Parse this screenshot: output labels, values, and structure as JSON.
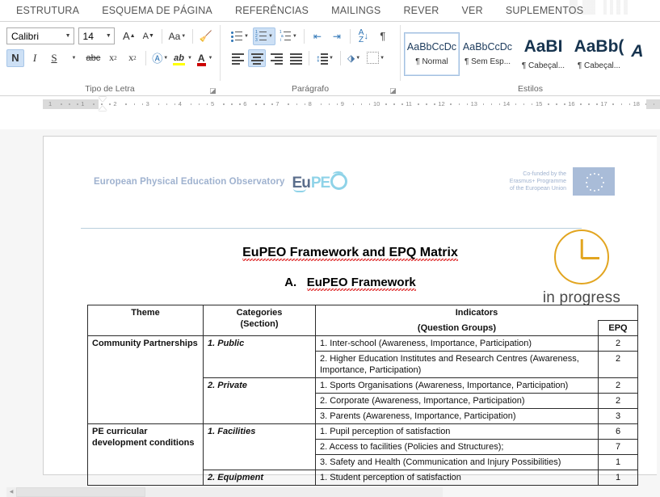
{
  "ribbon": {
    "tabs": [
      {
        "label": "ESTRUTURA",
        "active": false
      },
      {
        "label": "ESQUEMA DE PÁGINA",
        "active": false
      },
      {
        "label": "REFERÊNCIAS",
        "active": false
      },
      {
        "label": "MAILINGS",
        "active": false
      },
      {
        "label": "REVER",
        "active": false
      },
      {
        "label": "VER",
        "active": false
      },
      {
        "label": "SUPLEMENTOS",
        "active": false
      }
    ],
    "font_group": {
      "label": "Tipo de Letra",
      "font_name": "Calibri",
      "font_size": "14",
      "grow_font": "A",
      "shrink_font": "A",
      "change_case": "Aa",
      "clear_formatting": "clear-formatting-icon",
      "bold": "N",
      "italic": "I",
      "underline": "S",
      "strikethrough": "abc",
      "subscript": "x₂",
      "superscript": "x²",
      "text_effects": "A",
      "highlight": "ab",
      "font_color": "A"
    },
    "paragraph_group": {
      "label": "Parágrafo",
      "bullets": "bullet-list-icon",
      "numbering": "numbered-list-icon",
      "multilevel": "multilevel-list-icon",
      "decrease_indent": "decrease-indent-icon",
      "increase_indent": "increase-indent-icon",
      "sort": "sort-icon",
      "show_marks": "¶",
      "align_left": "align-left-icon",
      "align_center": "align-center-icon",
      "align_right": "align-right-icon",
      "justify": "justify-icon",
      "line_spacing": "line-spacing-icon",
      "shading": "shading-icon",
      "borders": "borders-icon"
    },
    "styles_group": {
      "label": "Estilos",
      "items": [
        {
          "sample": "AaBbCcDc",
          "name": "¶ Normal",
          "selected": true,
          "big": false
        },
        {
          "sample": "AaBbCcDc",
          "name": "¶ Sem Esp...",
          "selected": false,
          "big": false
        },
        {
          "sample": "AaBI",
          "name": "¶ Cabeçal...",
          "selected": false,
          "big": true
        },
        {
          "sample": "AaBb(",
          "name": "¶ Cabeçal...",
          "selected": false,
          "big": true
        },
        {
          "sample": "A",
          "name": "",
          "selected": false,
          "big": true
        }
      ]
    }
  },
  "ruler": {
    "ticks": [
      "1",
      "1",
      "2",
      "3",
      "4",
      "5",
      "6",
      "7",
      "8",
      "9",
      "10",
      "11",
      "12",
      "13",
      "14",
      "15",
      "16",
      "17",
      "18"
    ]
  },
  "document": {
    "brand_text": "European Physical Education Observatory",
    "logo": {
      "eu": "Eu",
      "pe": "PE",
      "o": "o-ring-icon"
    },
    "erasmus": {
      "line1": "Co-funded by the",
      "line2": "Erasmus+ Programme",
      "line3": "of the European Union",
      "flag": "eu-flag-icon"
    },
    "title": "EuPEO Framework and EPQ Matrix",
    "subtitle_letter": "A.",
    "subtitle": "EuPEO Framework",
    "status": {
      "icon": "clock-icon",
      "label": "in progress",
      "color": "#e2a520"
    },
    "table": {
      "headers": {
        "theme": "Theme",
        "categories_l1": "Categories",
        "categories_l2": "(Section)",
        "indicators_l1": "Indicators",
        "indicators_l2": "(Question Groups)",
        "epq": "EPQ"
      },
      "rows": [
        {
          "theme": "Community Partnerships",
          "theme_rowspan": 5,
          "category": "1. Public",
          "cat_rowspan": 2,
          "indicator": "1. Inter-school (Awareness, Importance, Participation)",
          "epq": "2"
        },
        {
          "theme": null,
          "category": null,
          "indicator": "2. Higher Education Institutes and Research Centres (Awareness, Importance, Participation)",
          "epq": "2"
        },
        {
          "theme": null,
          "category": "2. Private",
          "cat_rowspan": 3,
          "indicator": "1. Sports Organisations (Awareness, Importance, Participation)",
          "epq": "2"
        },
        {
          "theme": null,
          "category": null,
          "indicator": "2. Corporate (Awareness, Importance, Participation)",
          "epq": "2"
        },
        {
          "theme": null,
          "category": null,
          "indicator": "3. Parents (Awareness, Importance, Participation)",
          "epq": "3"
        },
        {
          "theme": "PE curricular development conditions",
          "theme_rowspan": 4,
          "category": "1. Facilities",
          "cat_rowspan": 3,
          "indicator": "1. Pupil perception of satisfaction",
          "epq": "6"
        },
        {
          "theme": null,
          "category": null,
          "indicator": "2. Access to facilities (Policies and Structures);",
          "epq": "7"
        },
        {
          "theme": null,
          "category": null,
          "indicator": "3. Safety and Health (Communication and Injury Possibilities)",
          "epq": "1"
        },
        {
          "theme": null,
          "category": "2. Equipment",
          "cat_rowspan": 1,
          "indicator": "1. Student perception of satisfaction",
          "epq": "1"
        }
      ]
    }
  }
}
